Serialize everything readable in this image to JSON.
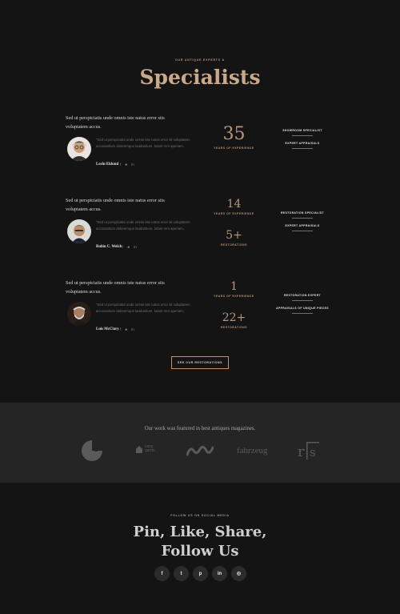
{
  "specialists": {
    "eyebrow": "OUR ANTIQUE EXPERTS &",
    "title": "Specialists",
    "people": [
      {
        "quote": "Sed ut perspiciatis unde omnis iste natus error sits voluptatem accus.",
        "bio": "\"Sed ut perspiciatis unde omnis iste natus error sit voluptatem accusantium doloremque laudantium, totam rem aperiam.",
        "name": "Lorin Eklund",
        "stats": [
          {
            "value": "35",
            "label": "YEARS OF EXPERIENCE"
          }
        ],
        "roles": [
          "SHOWROOM SPECIALIST",
          "EXPERT APPRAISALS"
        ]
      },
      {
        "quote": "Sed ut perspiciatis unde omnis iste natus error sits voluptatem accus.",
        "bio": "\"Sed ut perspiciatis unde omnis iste natus error sit voluptatem accusantium doloremque laudantium, totam rem aperiam.",
        "name": "Robin C. Welch",
        "stats": [
          {
            "value": "14",
            "label": "YEARS OF EXPERIENCE"
          },
          {
            "value": "5+",
            "label": "RESTORATIONS"
          }
        ],
        "roles": [
          "RESTORATION SPECIALIST",
          "EXPERT APPRAISALS"
        ]
      },
      {
        "quote": "Sed ut perspiciatis unde omnis iste natus error sits voluptatem accus.",
        "bio": "\"Sed ut perspiciatis unde omnis iste natus error sit voluptatem accusantium doloremque laudantium, totam rem aperiam.",
        "name": "Luis McClary",
        "stats": [
          {
            "value": "1",
            "label": "YEARS OF EXPERIENCE"
          },
          {
            "value": "22+",
            "label": "RESTORATIONS"
          }
        ],
        "roles": [
          "RESTORATION EXPERT",
          "APPRAISALS OF UNIQUE PIECES"
        ]
      }
    ],
    "social_glyphs": {
      "facebook": "f",
      "twitter": "♣",
      "linkedin": "in"
    },
    "cta_label": "SEE OUR RESTORATIONS"
  },
  "featured": {
    "lead": "Our work was featured in best antiques magazines.",
    "logos": [
      {
        "name": "c-mark-logo",
        "text": ""
      },
      {
        "name": "casa-gardo-logo",
        "text": "casa gardo"
      },
      {
        "name": "wave-logo",
        "text": ""
      },
      {
        "name": "fahrzeug-logo",
        "text": "fahrzeug"
      },
      {
        "name": "rfs-logo",
        "text": "r|s"
      }
    ]
  },
  "social": {
    "eyebrow": "FOLLOW US ON SOCIAL MEDIA",
    "headline_line1": "Pin, Like, Share,",
    "headline_line2": "Follow Us",
    "icons": [
      {
        "name": "facebook-icon",
        "glyph": "f"
      },
      {
        "name": "twitter-icon",
        "glyph": "t"
      },
      {
        "name": "pinterest-icon",
        "glyph": "p"
      },
      {
        "name": "linkedin-icon",
        "glyph": "in"
      },
      {
        "name": "instagram-icon",
        "glyph": "◎"
      }
    ]
  },
  "colors": {
    "background": "#141414",
    "band": "#252525",
    "accent": "#b8977a"
  }
}
